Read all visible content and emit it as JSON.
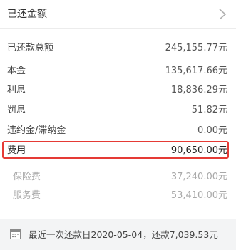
{
  "header": {
    "title": "已还金额"
  },
  "rows": [
    {
      "label": "已还款总额",
      "value": "245,155.77元"
    },
    {
      "label": "本金",
      "value": "135,617.66元"
    },
    {
      "label": "利息",
      "value": "18,836.29元"
    },
    {
      "label": "罚息",
      "value": "51.82元"
    },
    {
      "label": "违约金/滞纳金",
      "value": "0.00元"
    },
    {
      "label": "费用",
      "value": "90,650.00元"
    }
  ],
  "sub_rows": [
    {
      "label": "保险费",
      "value": "37,240.00元"
    },
    {
      "label": "服务费",
      "value": "53,410.00元"
    }
  ],
  "footer": {
    "text": "最近一次还款日2020-05-04，还款7,039.53元"
  },
  "colors": {
    "highlight_border": "#e53a35"
  }
}
